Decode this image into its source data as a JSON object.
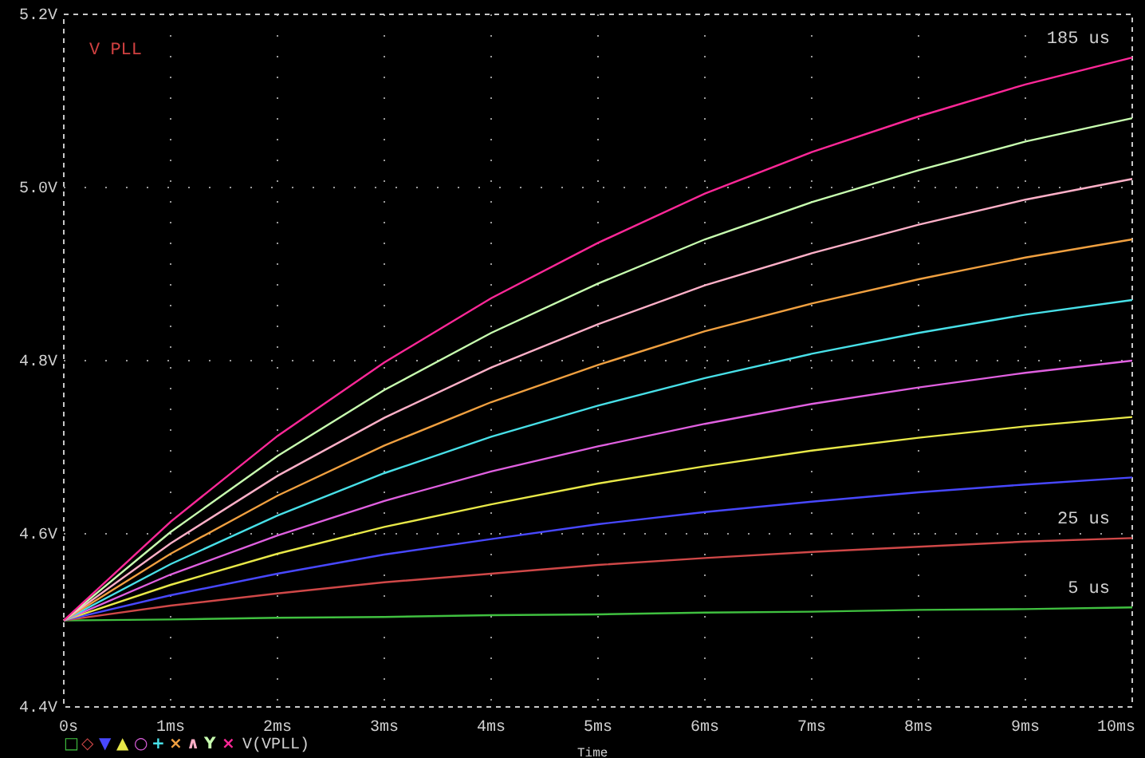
{
  "plot": {
    "chart_data": {
      "type": "line",
      "title": "V PLL",
      "xlabel": "Time",
      "x": [
        0,
        1,
        2,
        3,
        4,
        5,
        6,
        7,
        8,
        9,
        10
      ],
      "xlim": [
        0,
        10
      ],
      "ylim": [
        4.4,
        5.2
      ],
      "grid": true,
      "xticks": [
        {
          "value": 0,
          "label": "0s"
        },
        {
          "value": 1,
          "label": "1ms"
        },
        {
          "value": 2,
          "label": "2ms"
        },
        {
          "value": 3,
          "label": "3ms"
        },
        {
          "value": 4,
          "label": "4ms"
        },
        {
          "value": 5,
          "label": "5ms"
        },
        {
          "value": 6,
          "label": "6ms"
        },
        {
          "value": 7,
          "label": "7ms"
        },
        {
          "value": 8,
          "label": "8ms"
        },
        {
          "value": 9,
          "label": "9ms"
        },
        {
          "value": 10,
          "label": "10ms"
        }
      ],
      "yticks": [
        {
          "value": 4.4,
          "label": "4.4V"
        },
        {
          "value": 4.6,
          "label": "4.6V"
        },
        {
          "value": 4.8,
          "label": "4.8V"
        },
        {
          "value": 5.0,
          "label": "5.0V"
        },
        {
          "value": 5.2,
          "label": "5.2V"
        }
      ],
      "series": [
        {
          "color": "#40c040",
          "values": [
            4.5,
            4.501,
            4.503,
            4.504,
            4.506,
            4.507,
            4.509,
            4.51,
            4.512,
            4.513,
            4.515
          ]
        },
        {
          "color": "#d04848",
          "values": [
            4.5,
            4.517,
            4.531,
            4.544,
            4.554,
            4.564,
            4.572,
            4.579,
            4.585,
            4.591,
            4.595
          ]
        },
        {
          "color": "#4848ff",
          "values": [
            4.5,
            4.529,
            4.554,
            4.576,
            4.594,
            4.611,
            4.625,
            4.637,
            4.648,
            4.657,
            4.665
          ]
        },
        {
          "color": "#e8e848",
          "values": [
            4.5,
            4.541,
            4.577,
            4.608,
            4.634,
            4.658,
            4.678,
            4.696,
            4.711,
            4.724,
            4.735
          ]
        },
        {
          "color": "#e060e0",
          "values": [
            4.5,
            4.553,
            4.598,
            4.638,
            4.672,
            4.701,
            4.727,
            4.75,
            4.769,
            4.786,
            4.8
          ]
        },
        {
          "color": "#48e0e8",
          "values": [
            4.5,
            4.565,
            4.621,
            4.67,
            4.712,
            4.748,
            4.78,
            4.808,
            4.832,
            4.853,
            4.87
          ]
        },
        {
          "color": "#f0a040",
          "values": [
            4.5,
            4.577,
            4.644,
            4.702,
            4.752,
            4.795,
            4.834,
            4.866,
            4.894,
            4.919,
            4.94
          ]
        },
        {
          "color": "#ffb0c8",
          "values": [
            4.5,
            4.589,
            4.667,
            4.734,
            4.792,
            4.842,
            4.887,
            4.924,
            4.957,
            4.986,
            5.01
          ]
        },
        {
          "color": "#c8ffb0",
          "values": [
            4.5,
            4.602,
            4.69,
            4.766,
            4.832,
            4.889,
            4.94,
            4.983,
            5.02,
            5.053,
            5.08
          ]
        },
        {
          "color": "#ff2898",
          "values": [
            4.5,
            4.614,
            4.713,
            4.798,
            4.872,
            4.936,
            4.993,
            5.041,
            5.082,
            5.119,
            5.15
          ]
        }
      ]
    },
    "trace_notes": [
      "185 us",
      "25 us",
      "5 us"
    ],
    "legend": {
      "markers": [
        {
          "symbol": "□",
          "color": "#40c040"
        },
        {
          "symbol": "◇",
          "color": "#d04848"
        },
        {
          "symbol": "▼",
          "color": "#4848ff"
        },
        {
          "symbol": "▲",
          "color": "#e8e848"
        },
        {
          "symbol": "○",
          "color": "#e060e0"
        },
        {
          "symbol": "+",
          "color": "#48e0e8"
        },
        {
          "symbol": "×",
          "color": "#f0a040"
        },
        {
          "symbol": "∧",
          "color": "#ffb0c8"
        },
        {
          "symbol": "Y",
          "color": "#c8ffb0"
        },
        {
          "symbol": "×",
          "color": "#ff2898"
        }
      ],
      "label": "V(VPLL)"
    }
  }
}
